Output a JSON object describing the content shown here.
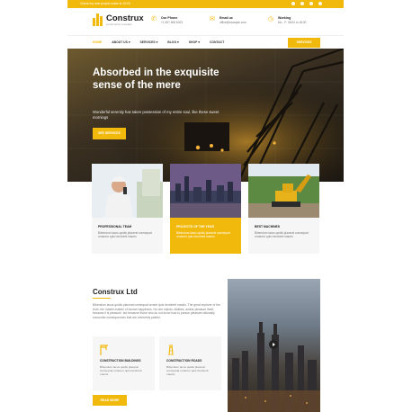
{
  "topbar": {
    "promo": "Check my new project make at 10:00"
  },
  "logo": {
    "name": "Construx",
    "tagline": "construction template"
  },
  "header": {
    "phone": {
      "title": "Our Phone",
      "value": "+1 657 608 6023"
    },
    "email": {
      "title": "Email us",
      "value": "office@example.com"
    },
    "hours": {
      "title": "Working",
      "value": "Mo - F: 08:00 to 18:00"
    }
  },
  "nav": {
    "items": [
      "HOME",
      "ABOUT US ▾",
      "SERVICES ▾",
      "BLOG ▾",
      "SHOP ▾",
      "CONTACT"
    ],
    "cta": "SERVICES"
  },
  "hero": {
    "title": "Absorbed in the exquisite sense of the mere",
    "subtitle": "Wonderful serenity has taken possession of my entire soul, like these sweet mornings",
    "button": "SEE SERVICES"
  },
  "cards": [
    {
      "title": "PROFESSIONAL TEAM",
      "text": "Bibendum lacus quidis placerat consequat ornareor quis hendrerit mauris"
    },
    {
      "title": "PROJECTS OF THE YEAR",
      "text": "Bibendum lacus quidis placerat consequat ornareor quis hendrerit mauris"
    },
    {
      "title": "BEST MACHINES",
      "text": "Bibendum lacus quidis placerat consequat ornareor quis hendrerit mauris"
    }
  ],
  "about": {
    "title": "Construx Ltd",
    "text": "Bibendum lacus quidis placerat consequat ornare quis hendrerit mauris. The great explorer of the truth, the master-builder of human happiness. No one rejects, dislikes, avoids pleasure itself, because it is pleasure, but because those who do not know how to pursue pleasure rationally encounter consequences that are extremely painful.",
    "services": [
      {
        "title": "CONSTRUCTION BUILDINGS",
        "text": "Bibendum lacus quidis placerat consequat ornareor quis hendrerit mauris"
      },
      {
        "title": "CONSTRUCTION ROADS",
        "text": "Bibendum lacus quidis placerat consequat ornareor quis hendrerit mauris"
      }
    ],
    "button": "READ MORE"
  },
  "colors": {
    "accent": "#f2b90d",
    "dark": "#222222"
  }
}
